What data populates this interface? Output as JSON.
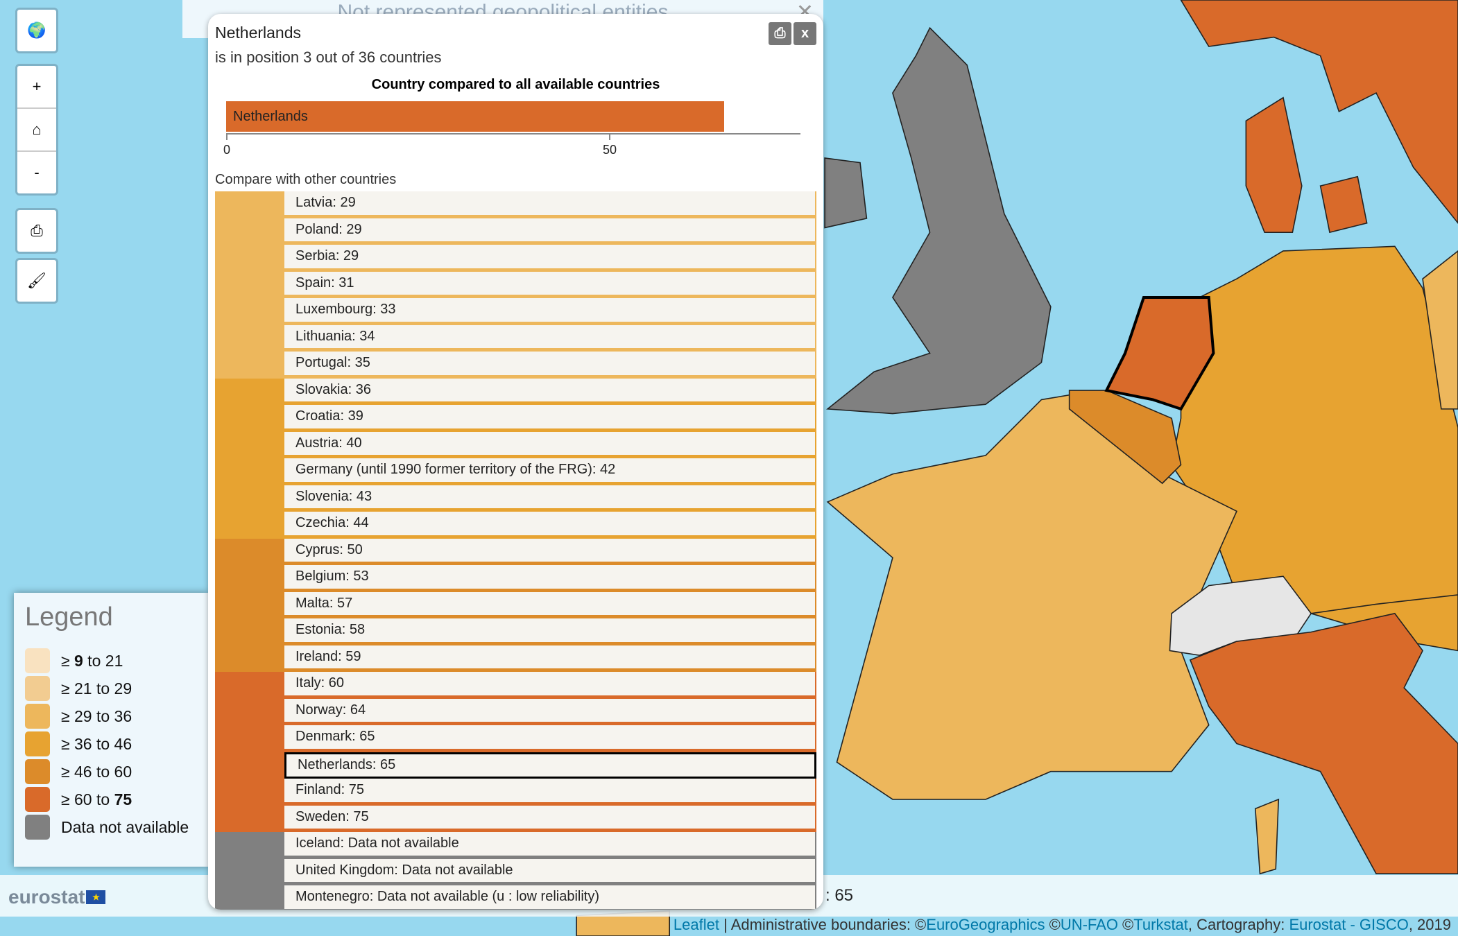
{
  "map_controls": {
    "globe_icon": "globe-icon",
    "zoom_in": "+",
    "home_icon": "home-icon",
    "zoom_out": "-",
    "print_icon": "print-icon",
    "style_icon": "brush-icon"
  },
  "banner": {
    "text": "Not represented geopolitical entities",
    "close": "✕"
  },
  "popup": {
    "title": "Netherlands",
    "subtitle": "is in position 3 out of 36 countries",
    "print_icon": "print-icon",
    "close_label": "x",
    "compare_label": "Compare with other countries"
  },
  "chart_data": {
    "type": "bar",
    "title": "Country compared to all available countries",
    "categories": [
      "Netherlands"
    ],
    "values": [
      65
    ],
    "xlim": [
      0,
      75
    ],
    "ticks": [
      "0",
      "50"
    ],
    "color": "#d96a2a"
  },
  "colors": {
    "c29_36": "#edb75c",
    "c36_46": "#e7a331",
    "c46_60": "#dc8b2a",
    "c60_75": "#d96a2a",
    "na": "#808080",
    "sea": "#97d8ef"
  },
  "countries": [
    {
      "label": "Latvia: 29",
      "group": "c29_36"
    },
    {
      "label": "Poland: 29",
      "group": "c29_36"
    },
    {
      "label": "Serbia: 29",
      "group": "c29_36"
    },
    {
      "label": "Spain: 31",
      "group": "c29_36"
    },
    {
      "label": "Luxembourg: 33",
      "group": "c29_36"
    },
    {
      "label": "Lithuania: 34",
      "group": "c29_36"
    },
    {
      "label": "Portugal: 35",
      "group": "c29_36"
    },
    {
      "label": "Slovakia: 36",
      "group": "c36_46"
    },
    {
      "label": "Croatia: 39",
      "group": "c36_46"
    },
    {
      "label": "Austria: 40",
      "group": "c36_46"
    },
    {
      "label": "Germany (until 1990 former territory of the FRG): 42",
      "group": "c36_46"
    },
    {
      "label": "Slovenia: 43",
      "group": "c36_46"
    },
    {
      "label": "Czechia: 44",
      "group": "c36_46"
    },
    {
      "label": "Cyprus: 50",
      "group": "c46_60"
    },
    {
      "label": "Belgium: 53",
      "group": "c46_60"
    },
    {
      "label": "Malta: 57",
      "group": "c46_60"
    },
    {
      "label": "Estonia: 58",
      "group": "c46_60"
    },
    {
      "label": "Ireland: 59",
      "group": "c46_60"
    },
    {
      "label": "Italy: 60",
      "group": "c60_75"
    },
    {
      "label": "Norway: 64",
      "group": "c60_75"
    },
    {
      "label": "Denmark: 65",
      "group": "c60_75"
    },
    {
      "label": "Netherlands: 65",
      "group": "c60_75",
      "selected": true
    },
    {
      "label": "Finland: 75",
      "group": "c60_75"
    },
    {
      "label": "Sweden: 75",
      "group": "c60_75"
    },
    {
      "label": "Iceland: Data not available",
      "group": "na"
    },
    {
      "label": "United Kingdom: Data not available",
      "group": "na"
    },
    {
      "label": "Montenegro: Data not available (u : low reliability)",
      "group": "na"
    }
  ],
  "legend": {
    "title": "Legend",
    "items": [
      {
        "prefix": "≥ ",
        "bold1": "9",
        "mid": " to 21",
        "bold2": "",
        "color": "#f9e2c0"
      },
      {
        "prefix": "≥ 21 to 29",
        "bold1": "",
        "mid": "",
        "bold2": "",
        "color": "#f2cc91"
      },
      {
        "prefix": "≥ 29 to 36",
        "bold1": "",
        "mid": "",
        "bold2": "",
        "color": "#edb75c"
      },
      {
        "prefix": "≥ 36 to 46",
        "bold1": "",
        "mid": "",
        "bold2": "",
        "color": "#e7a331"
      },
      {
        "prefix": "≥ 46 to 60",
        "bold1": "",
        "mid": "",
        "bold2": "",
        "color": "#dc8b2a"
      },
      {
        "prefix": "≥ 60 to ",
        "bold1": "",
        "mid": "",
        "bold2": "75",
        "color": "#d96a2a"
      },
      {
        "prefix": "Data not available",
        "bold1": "",
        "mid": "",
        "bold2": "",
        "color": "#808080"
      }
    ]
  },
  "footer": {
    "logo": "eurostat",
    "value": ": 65",
    "attribution": {
      "leaflet": "Leaflet",
      "sep": " | Administrative boundaries: ©",
      "eurogeo": "EuroGeographics",
      "sp1": " ©",
      "unfao": "UN-FAO",
      "sp2": " ©",
      "turkstat": "Turkstat",
      "sp3": ", Cartography: ",
      "gisco": "Eurostat - GISCO",
      "year": ", 2019"
    }
  }
}
